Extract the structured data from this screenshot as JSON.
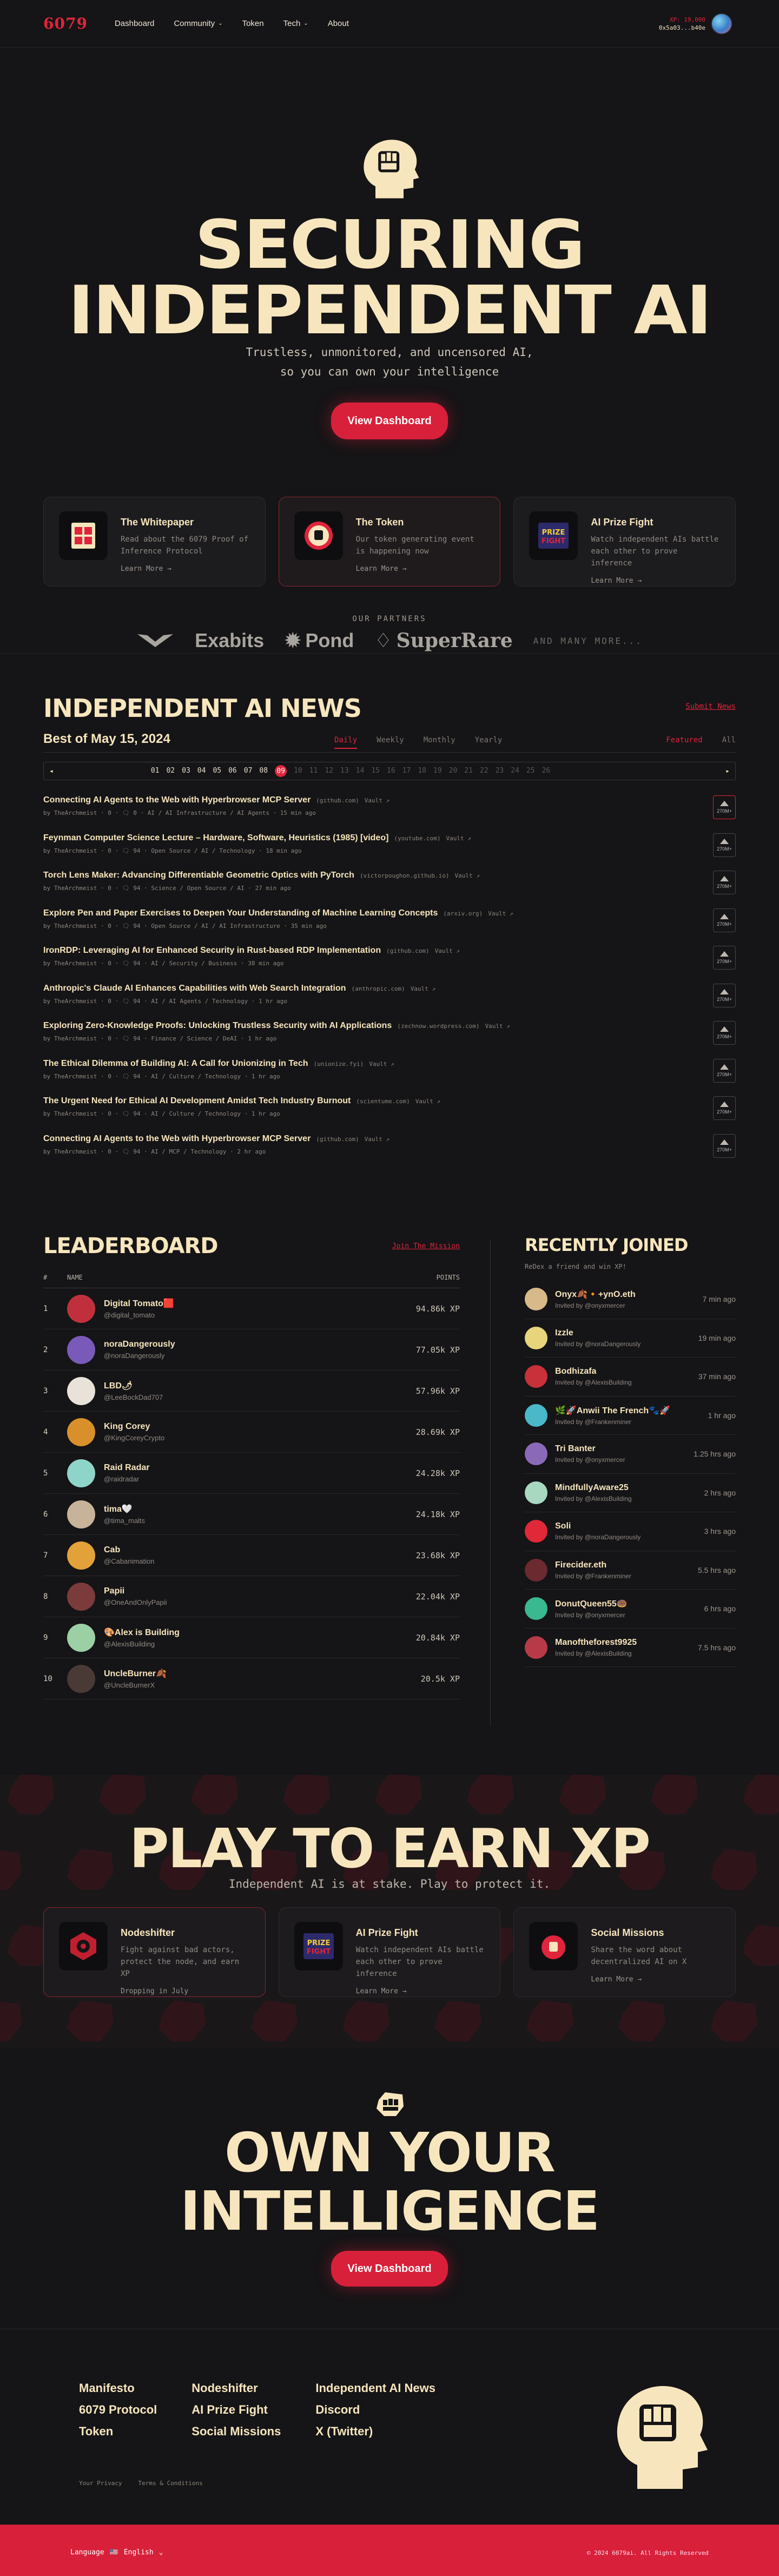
{
  "nav": {
    "logo": "6079",
    "links": [
      "Dashboard",
      "Community",
      "Token",
      "Tech",
      "About"
    ],
    "wallet_xp": "XP: 19,000",
    "wallet_addr": "0x5a03...b40e"
  },
  "hero": {
    "title_line1": "SECURING",
    "title_line2": "INDEPENDENT AI",
    "subtitle_line1": "Trustless, unmonitored, and uncensored AI,",
    "subtitle_line2": "so you can own your intelligence",
    "cta": "View Dashboard"
  },
  "feature_cards": [
    {
      "title": "The Whitepaper",
      "desc": "Read about the 6079 Proof of Inference Protocol",
      "more": "Learn More →"
    },
    {
      "title": "The Token",
      "desc": "Our token generating event is happening now",
      "more": "Learn More →"
    },
    {
      "title": "AI Prize Fight",
      "desc": "Watch independent AIs battle each other to prove inference",
      "more": "Learn More →"
    }
  ],
  "partners": {
    "label": "OUR PARTNERS",
    "names": [
      "Exabits",
      "Pond",
      "SuperRare"
    ],
    "more": "AND MANY MORE..."
  },
  "news": {
    "title": "INDEPENDENT AI NEWS",
    "submit": "Submit News",
    "best": "Best of May 15, 2024",
    "tabs": [
      "Daily",
      "Weekly",
      "Monthly",
      "Yearly"
    ],
    "filters": [
      "Featured",
      "All"
    ],
    "days": [
      "01",
      "02",
      "03",
      "04",
      "05",
      "06",
      "07",
      "08",
      "09",
      "10",
      "11",
      "12",
      "13",
      "14",
      "15",
      "16",
      "17",
      "18",
      "19",
      "20",
      "21",
      "22",
      "23",
      "24",
      "25",
      "26"
    ],
    "selected_day": "09",
    "items": [
      {
        "title": "Connecting AI Agents to the Web with Hyperbrowser MCP Server",
        "domain": "(github.com)",
        "tag": "Vault ↗",
        "meta": "by TheArchmeist · 0 · 🗨 0 · AI / AI Infrastructure / AI Agents · 15 min ago",
        "votes": "270M+"
      },
      {
        "title": "Feynman Computer Science Lecture – Hardware, Software, Heuristics (1985) [video]",
        "domain": "(youtube.com)",
        "tag": "Vault ↗",
        "meta": "by TheArchmeist · 0 · 🗨 94 · Open Source / AI / Technology · 18 min ago",
        "votes": "270M+"
      },
      {
        "title": "Torch Lens Maker: Advancing Differentiable Geometric Optics with PyTorch",
        "domain": "(victorpoughon.github.io)",
        "tag": "Vault ↗",
        "meta": "by TheArchmeist · 0 · 🗨 94 · Science / Open Source / AI · 27 min ago",
        "votes": "270M+"
      },
      {
        "title": "Explore Pen and Paper Exercises to Deepen Your Understanding of Machine Learning Concepts",
        "domain": "(arxiv.org)",
        "tag": "Vault ↗",
        "meta": "by TheArchmeist · 0 · 🗨 94 · Open Source / AI / AI Infrastructure · 35 min ago",
        "votes": "270M+"
      },
      {
        "title": "IronRDP: Leveraging AI for Enhanced Security in Rust-based RDP Implementation",
        "domain": "(github.com)",
        "tag": "Vault ↗",
        "meta": "by TheArchmeist · 0 · 🗨 94 · AI / Security / Business · 38 min ago",
        "votes": "270M+"
      },
      {
        "title": "Anthropic's Claude AI Enhances Capabilities with Web Search Integration",
        "domain": "(anthropic.com)",
        "tag": "Vault ↗",
        "meta": "by TheArchmeist · 0 · 🗨 94 · AI / AI Agents / Technology · 1 hr ago",
        "votes": "270M+"
      },
      {
        "title": "Exploring Zero-Knowledge Proofs: Unlocking Trustless Security with AI Applications",
        "domain": "(zechnow.wordpress.com)",
        "tag": "Vault ↗",
        "meta": "by TheArchmeist · 0 · 🗨 94 · Finance / Science / DeAI · 1 hr ago",
        "votes": "270M+"
      },
      {
        "title": "The Ethical Dilemma of Building AI: A Call for Unionizing in Tech",
        "domain": "(unionize.fyi)",
        "tag": "Vault ↗",
        "meta": "by TheArchmeist · 0 · 🗨 94 · AI / Culture / Technology · 1 hr ago",
        "votes": "270M+"
      },
      {
        "title": "The Urgent Need for Ethical AI Development Amidst Tech Industry Burnout",
        "domain": "(scientume.com)",
        "tag": "Vault ↗",
        "meta": "by TheArchmeist · 0 · 🗨 94 · AI / Culture / Technology · 1 hr ago",
        "votes": "270M+"
      },
      {
        "title": "Connecting AI Agents to the Web with Hyperbrowser MCP Server",
        "domain": "(github.com)",
        "tag": "Vault ↗",
        "meta": "by TheArchmeist · 0 · 🗨 94 · AI / MCP / Technology · 2 hr ago",
        "votes": "270M+"
      }
    ]
  },
  "leaderboard": {
    "title": "LEADERBOARD",
    "join": "Join The Mission",
    "col_rank": "#",
    "col_name": "NAME",
    "col_points": "POINTS",
    "rows": [
      {
        "rank": "1",
        "name": "Digital Tomato🟥",
        "handle": "@digital_tomato",
        "points": "94.86k XP",
        "color": "#c0303c"
      },
      {
        "rank": "2",
        "name": "noraDangerously",
        "handle": "@noraDangerously",
        "points": "77.05k XP",
        "color": "#7a5ab8"
      },
      {
        "rank": "3",
        "name": "LBD🌶",
        "handle": "@LeeBockDad707",
        "points": "57.96k XP",
        "color": "#e8e2d8"
      },
      {
        "rank": "4",
        "name": "King Corey",
        "handle": "@KingCoreyCrypto",
        "points": "28.69k XP",
        "color": "#d9902a"
      },
      {
        "rank": "5",
        "name": "Raid Radar",
        "handle": "@raidradar",
        "points": "24.28k XP",
        "color": "#8fd4c8"
      },
      {
        "rank": "6",
        "name": "tima🤍",
        "handle": "@tima_malts",
        "points": "24.18k XP",
        "color": "#c7b39a"
      },
      {
        "rank": "7",
        "name": "Cab",
        "handle": "@Cabanimation",
        "points": "23.68k XP",
        "color": "#e3a13a"
      },
      {
        "rank": "8",
        "name": "Papii",
        "handle": "@OneAndOnlyPapii",
        "points": "22.04k XP",
        "color": "#7a3b3a"
      },
      {
        "rank": "9",
        "name": "🎨Alex is Building",
        "handle": "@AlexisBuilding",
        "points": "20.84k XP",
        "color": "#9bd0a5"
      },
      {
        "rank": "10",
        "name": "UncleBurner🍂",
        "handle": "@UncleBurnerX",
        "points": "20.5k XP",
        "color": "#4a3a35"
      }
    ]
  },
  "recently_joined": {
    "title": "RECENTLY JOINED",
    "sub": "ReDex a friend and win XP!",
    "rows": [
      {
        "name": "Onyx🍂🔸+ynO.eth",
        "by": "Invited by @onyxmercer",
        "time": "7 min ago",
        "color": "#d8b98a"
      },
      {
        "name": "Izzle",
        "by": "Invited by @noraDangerously",
        "time": "19 min ago",
        "color": "#e8d47a"
      },
      {
        "name": "Bodhizafa",
        "by": "Invited by @AlexisBuilding",
        "time": "37 min ago",
        "color": "#c8303a"
      },
      {
        "name": "🌿🚀Anwii The French🐾🚀",
        "by": "Invited by @Frankenminer",
        "time": "1 hr ago",
        "color": "#4ab8c8"
      },
      {
        "name": "Tri Banter",
        "by": "Invited by @onyxmercer",
        "time": "1.25 hrs ago",
        "color": "#8a6ab8"
      },
      {
        "name": "MindfullyAware25",
        "by": "Invited by @AlexisBuilding",
        "time": "2 hrs ago",
        "color": "#a8d8c0"
      },
      {
        "name": "Soli",
        "by": "Invited by @noraDangerously",
        "time": "3 hrs ago",
        "color": "#e02838"
      },
      {
        "name": "Firecider.eth",
        "by": "Invited by @Frankenminer",
        "time": "5.5 hrs ago",
        "color": "#6a2a30"
      },
      {
        "name": "DonutQueen55🍩",
        "by": "Invited by @onyxmercer",
        "time": "6 hrs ago",
        "color": "#3ab890"
      },
      {
        "name": "Manoftheforest9925",
        "by": "Invited by @AlexisBuilding",
        "time": "7.5 hrs ago",
        "color": "#b83a48"
      }
    ]
  },
  "play": {
    "title": "PLAY TO EARN XP",
    "sub": "Independent AI is at stake. Play to protect it.",
    "cards": [
      {
        "title": "Nodeshifter",
        "desc": "Fight against bad actors, protect the node, and earn XP",
        "more": "Dropping in July"
      },
      {
        "title": "AI Prize Fight",
        "desc": "Watch independent AIs battle each other to prove inference",
        "more": "Learn More →"
      },
      {
        "title": "Social Missions",
        "desc": "Share the word about decentralized AI on X",
        "more": "Learn More →"
      }
    ]
  },
  "own": {
    "title_line1": "OWN YOUR",
    "title_line2": "INTELLIGENCE",
    "cta": "View Dashboard"
  },
  "footer": {
    "col1": [
      "Manifesto",
      "6079 Protocol",
      "Token"
    ],
    "col2": [
      "Nodeshifter",
      "AI Prize Fight",
      "Social Missions"
    ],
    "col3": [
      "Independent AI News",
      "Discord",
      "X (Twitter)"
    ],
    "legal": [
      "Your Privacy",
      "Terms & Conditions"
    ],
    "language_label": "Language",
    "language_value": "English",
    "rights": "© 2024 6079ai. All Rights Reserved"
  }
}
